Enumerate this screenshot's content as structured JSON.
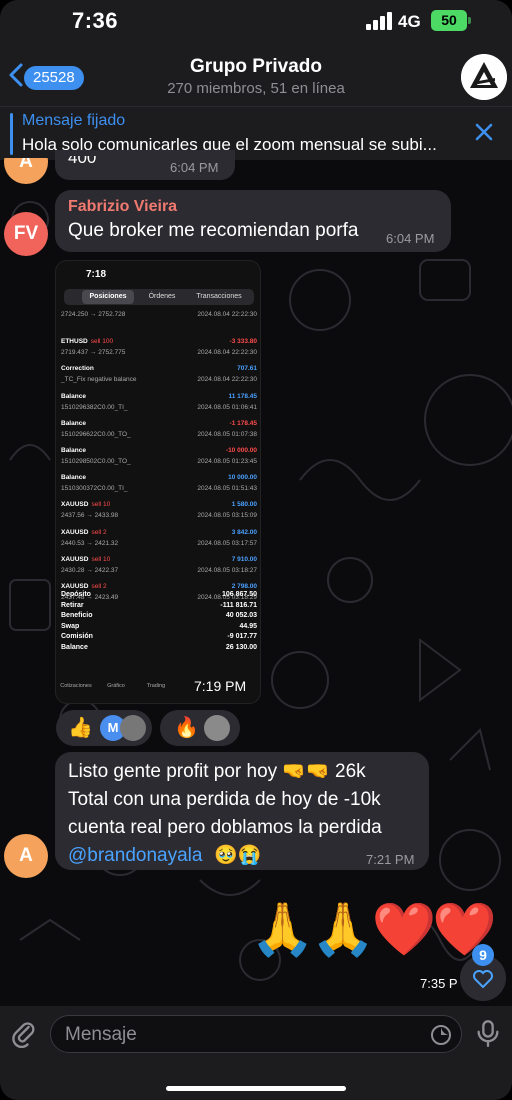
{
  "status": {
    "time": "7:36",
    "network": "4G",
    "battery": "50"
  },
  "header": {
    "back_count": "25528",
    "title": "Grupo Privado",
    "subtitle": "270 miembros, 51 en línea"
  },
  "pinned": {
    "label": "Mensaje fijado",
    "text": "Hola solo comunicarles que el zoom mensual se subi..."
  },
  "messages": [
    {
      "partial_text": "400",
      "time": "6:04 PM",
      "avatar": "A"
    },
    {
      "sender": "Fabrizio Vieira",
      "avatar": "FV",
      "text": "Que broker me recomiendan porfa",
      "time": "6:04 PM"
    },
    {
      "type": "image",
      "time": "7:19 PM",
      "reactions": [
        "👍",
        "🔥"
      ],
      "reaction_initial": "M"
    },
    {
      "avatar": "A",
      "lines": [
        "Listo gente profit por hoy 🤜🤜 26k",
        "Total con una perdida de hoy de -10k",
        "cuenta real pero doblamos la perdida"
      ],
      "mention": "@brandonayala",
      "mention_emoji": "🥹😭",
      "time": "7:21 PM"
    },
    {
      "type": "emoji",
      "text": "🙏🙏❤️❤️",
      "time": "7:35 P",
      "unread": "9"
    }
  ],
  "screenshot": {
    "time": "7:18",
    "tabs": [
      "Posiciones",
      "Órdenes",
      "Transacciones"
    ],
    "rows": [
      {
        "sym": "",
        "sub": "2724.250 → 2752.728",
        "val": "",
        "date": "2024.08.04 22:22:30"
      },
      {
        "sym": "ETHUSD",
        "side": "sell 100",
        "sub": "2719.437 → 2752.775",
        "val": "-3 333.80",
        "neg": true,
        "date": "2024.08.04 22:22:30"
      },
      {
        "sym": "Correction",
        "side": "",
        "sub": "_TC_Fix negative balance",
        "val": "707.61",
        "date": "2024.08.04 22:22:30"
      },
      {
        "sym": "Balance",
        "side": "",
        "sub": "1510296382C0.00_TI_",
        "val": "11 178.45",
        "date": "2024.08.05 01:06:41"
      },
      {
        "sym": "Balance",
        "side": "",
        "sub": "1510296622C0.00_TO_",
        "val": "-1 178.45",
        "neg": true,
        "date": "2024.08.05 01:07:38"
      },
      {
        "sym": "Balance",
        "side": "",
        "sub": "1510298502C0.00_TO_",
        "val": "-10 000.00",
        "neg": true,
        "date": "2024.08.05 01:23:45"
      },
      {
        "sym": "Balance",
        "side": "",
        "sub": "1510300372C0.00_TI_",
        "val": "10 000.00",
        "date": "2024.08.05 01:51:43"
      },
      {
        "sym": "XAUUSD",
        "side": "sell 10",
        "sub": "2437.56 → 2433.98",
        "val": "1 580.00",
        "date": "2024.08.05 03:15:09"
      },
      {
        "sym": "XAUUSD",
        "side": "sell 2",
        "sub": "2440.53 → 2421.32",
        "val": "3 842.00",
        "date": "2024.08.05 03:17:57"
      },
      {
        "sym": "XAUUSD",
        "side": "sell 10",
        "sub": "2430.28 → 2422.37",
        "val": "7 910.00",
        "date": "2024.08.05 03:18:27"
      },
      {
        "sym": "XAUUSD",
        "side": "sell 2",
        "sub": "2437.48 → 2423.49",
        "val": "2 798.00",
        "date": "2024.08.05 03:18:29"
      }
    ],
    "summary": [
      {
        "label": "Depósito",
        "value": "106 867.50"
      },
      {
        "label": "Retirar",
        "value": "-111 816.71"
      },
      {
        "label": "Beneficio",
        "value": "40 052.03"
      },
      {
        "label": "Swap",
        "value": "44.95"
      },
      {
        "label": "Comisión",
        "value": "-9 017.77"
      },
      {
        "label": "Balance",
        "value": "26 130.00"
      }
    ],
    "nav": [
      "Cotizaciones",
      "Gráfico",
      "Trading"
    ]
  },
  "input": {
    "placeholder": "Mensaje"
  },
  "colors": {
    "accent": "#3d8ff0",
    "bubble": "#2c2b31",
    "sender": "#f07a6f",
    "avatar_a": "#f5a35c",
    "avatar_fv": "#f0645c"
  }
}
